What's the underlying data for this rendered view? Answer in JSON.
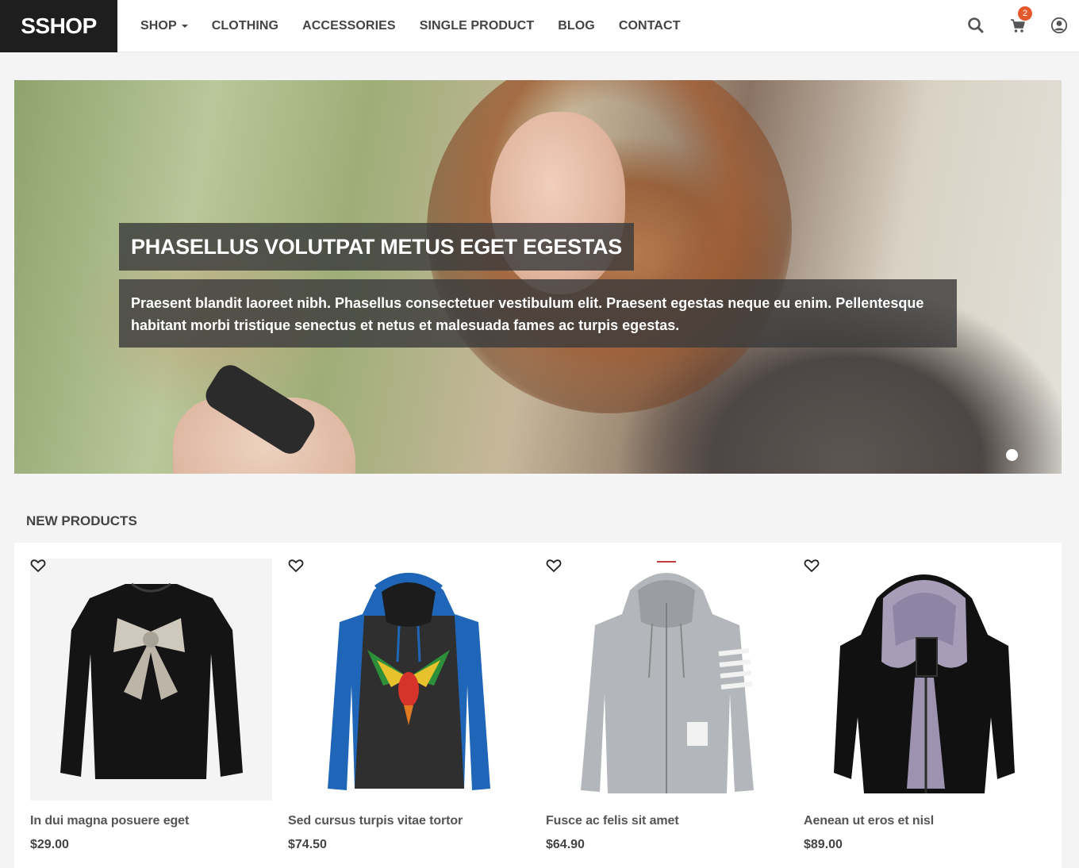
{
  "header": {
    "logo": "SSHOP",
    "nav": [
      {
        "label": "SHOP",
        "has_dropdown": true
      },
      {
        "label": "CLOTHING"
      },
      {
        "label": "ACCESSORIES"
      },
      {
        "label": "SINGLE PRODUCT"
      },
      {
        "label": "BLOG"
      },
      {
        "label": "CONTACT"
      }
    ],
    "icons": [
      "search-icon",
      "cart-icon",
      "user-icon"
    ],
    "cart_count": "2"
  },
  "hero": {
    "title": "PHASELLUS VOLUTPAT METUS EGET EGESTAS",
    "text": "Praesent blandit laoreet nibh. Phasellus consectetuer vestibulum elit. Praesent egestas neque eu enim. Pellentesque habitant morbi tristique senectus et netus et malesuada fames ac turpis egestas.",
    "slide_count": 1,
    "active_slide": 1
  },
  "new_products": {
    "title": "NEW PRODUCTS",
    "items": [
      {
        "name": "In dui magna posuere eget",
        "price": "$29.00"
      },
      {
        "name": "Sed cursus turpis vitae tortor",
        "price": "$74.50"
      },
      {
        "name": "Fusce ac felis sit amet",
        "price": "$64.90"
      },
      {
        "name": "Aenean ut eros et nisl",
        "price": "$89.00"
      }
    ]
  },
  "colors": {
    "logo_bg": "#1e1e1e",
    "badge": "#e4592c",
    "overlay": "rgba(60,60,60,0.82)"
  }
}
